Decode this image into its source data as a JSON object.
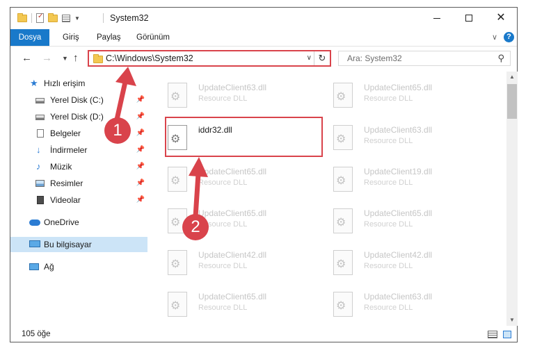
{
  "window": {
    "title": "System32",
    "controls": {
      "minimize": "minimize",
      "maximize": "maximize",
      "close": "✕"
    }
  },
  "ribbon": {
    "tabs": [
      "Dosya",
      "Giriş",
      "Paylaş",
      "Görünüm"
    ],
    "help": "?"
  },
  "nav": {
    "address": "C:\\Windows\\System32",
    "search_placeholder": "Ara: System32"
  },
  "sidebar": {
    "items": [
      {
        "label": "Hızlı erişim",
        "icon": "star-icon",
        "pinned": false
      },
      {
        "label": "Yerel Disk (C:)",
        "icon": "disk-icon",
        "pinned": true
      },
      {
        "label": "Yerel Disk (D:)",
        "icon": "disk-icon",
        "pinned": true
      },
      {
        "label": "Belgeler",
        "icon": "document-icon",
        "pinned": true
      },
      {
        "label": "İndirmeler",
        "icon": "download-icon",
        "pinned": true
      },
      {
        "label": "Müzik",
        "icon": "music-icon",
        "pinned": true
      },
      {
        "label": "Resimler",
        "icon": "pictures-icon",
        "pinned": true
      },
      {
        "label": "Videolar",
        "icon": "video-icon",
        "pinned": true
      },
      {
        "label": "OneDrive",
        "icon": "cloud-icon",
        "pinned": false
      },
      {
        "label": "Bu bilgisayar",
        "icon": "computer-icon",
        "pinned": false,
        "selected": true
      },
      {
        "label": "Ağ",
        "icon": "network-icon",
        "pinned": false
      }
    ]
  },
  "files": {
    "left_column": [
      {
        "name": "UpdateClient63.dll",
        "type": "Resource DLL"
      },
      {
        "name": "iddr32.dll",
        "type": "",
        "focused": true
      },
      {
        "name": "UpdateClient65.dll",
        "type": "Resource DLL"
      },
      {
        "name": "UpdateClient65.dll",
        "type": "Resource DLL"
      },
      {
        "name": "UpdateClient42.dll",
        "type": "Resource DLL"
      },
      {
        "name": "UpdateClient65.dll",
        "type": "Resource DLL"
      }
    ],
    "right_column": [
      {
        "name": "UpdateClient65.dll",
        "type": "Resource DLL"
      },
      {
        "name": "UpdateClient63.dll",
        "type": "Resource DLL"
      },
      {
        "name": "UpdateClient19.dll",
        "type": "Resource DLL"
      },
      {
        "name": "UpdateClient65.dll",
        "type": "Resource DLL"
      },
      {
        "name": "UpdateClient42.dll",
        "type": "Resource DLL"
      },
      {
        "name": "UpdateClient63.dll",
        "type": "Resource DLL"
      }
    ]
  },
  "status": {
    "count": "105 öğe"
  },
  "annotations": {
    "step1": "1",
    "step2": "2",
    "color": "#d9434b"
  },
  "colors": {
    "accent": "#1979ca",
    "highlight": "#d9434b",
    "selection": "#cce4f7"
  }
}
